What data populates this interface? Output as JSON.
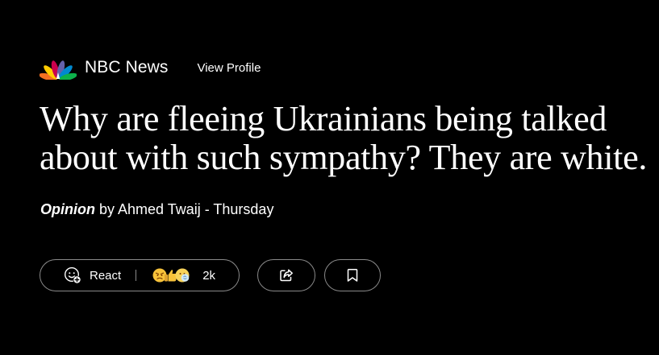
{
  "publisher": {
    "name": "NBC News",
    "view_profile_label": "View Profile",
    "logo_icon": "nbc-peacock-logo"
  },
  "article": {
    "headline": "Why are fleeing Ukrainians being talked about with such sympathy? They are white.",
    "byline": {
      "label": "Opinion",
      "author_text": " by Ahmed Twaij",
      "separator": " - ",
      "date": "Thursday"
    }
  },
  "actions": {
    "react_label": "React",
    "react_icon": "add-reaction-icon",
    "reaction_emojis": [
      "angry-face-icon",
      "thumbs-up-icon",
      "thinking-face-icon"
    ],
    "reaction_count": "2k",
    "share_icon": "share-icon",
    "save_icon": "bookmark-icon"
  },
  "colors": {
    "background": "#000000",
    "text": "#ffffff",
    "border": "#8a8a8a",
    "peacock": [
      "#ffcc00",
      "#f37021",
      "#cc004c",
      "#6460aa",
      "#0089d0",
      "#0db14b"
    ]
  }
}
